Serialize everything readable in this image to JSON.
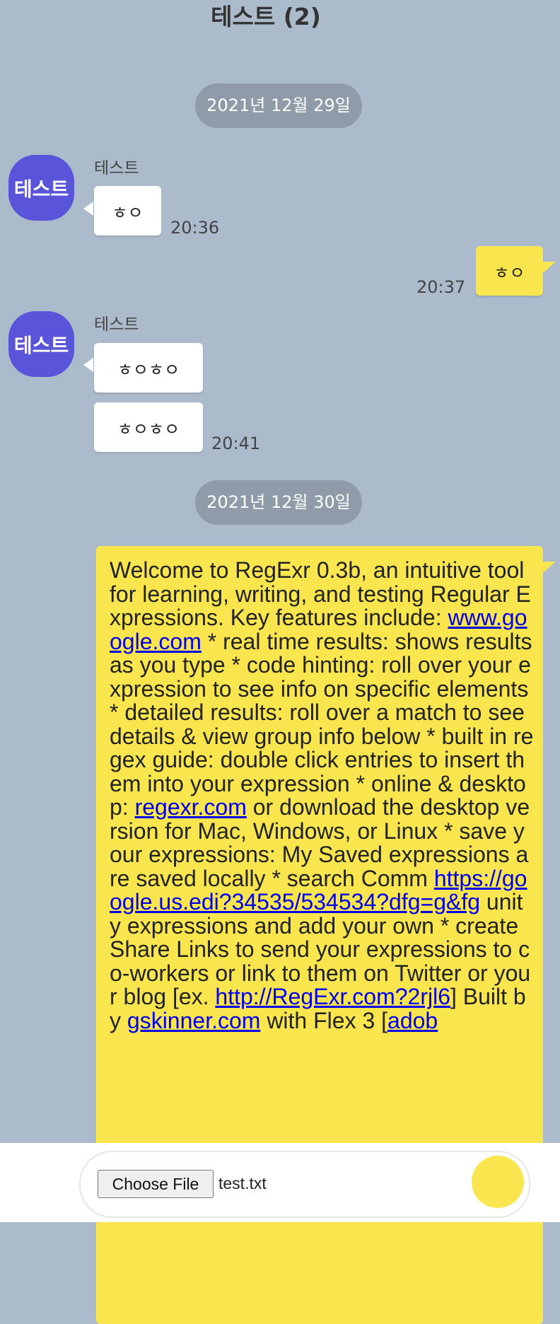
{
  "header": {
    "title": "테스트 (2)"
  },
  "dates": [
    "2021년 12월 29일",
    "2021년 12월 30일"
  ],
  "avatar_label": "테스트",
  "sender_name": "테스트",
  "messages": [
    {
      "text": "ㅎㅇ",
      "time": "20:36"
    },
    {
      "text": "ㅎㅇ",
      "time": "20:37"
    },
    {
      "text": "ㅎㅇㅎㅇ",
      "time": ""
    },
    {
      "text": "ㅎㅇㅎㅇ",
      "time": "20:41"
    }
  ],
  "long_message": {
    "segments": [
      {
        "t": "Welcome to RegExr 0.3b, an intuitive tool for learning, writing, and testing Regular Expressions. Key features include: "
      },
      {
        "link": "www.google.com"
      },
      {
        "t": " * real time results: shows results as you type * code hinting: roll over your expression to see info on specific elements * detailed results: roll over a match to see details & view group info below * built in regex guide: double click entries to insert them into your expression * online & desktop: "
      },
      {
        "link": "regexr.com"
      },
      {
        "t": " or download the desktop version for Mac, Windows, or Linux * save your expressions: My Saved expressions are saved locally * search Comm "
      },
      {
        "link": "https://google.us.edi?34535/534534?dfg=g&fg"
      },
      {
        "t": " unity expressions and add your own * create Share Links to send your expressions to co-workers or link to them on Twitter or your blog [ex. "
      },
      {
        "link": "http://RegExr.com?2rjl6"
      },
      {
        "t": "] Built by "
      },
      {
        "link": "gskinner.com"
      },
      {
        "t": " with Flex 3 ["
      },
      {
        "link": "adob"
      }
    ]
  },
  "composer": {
    "file_button_label": "Choose File",
    "file_name": "test.txt"
  },
  "colors": {
    "background": "#abbbcc",
    "own_bubble": "#f9e54e",
    "avatar": "#5a54db",
    "date_pill": "#8f9ba8"
  }
}
